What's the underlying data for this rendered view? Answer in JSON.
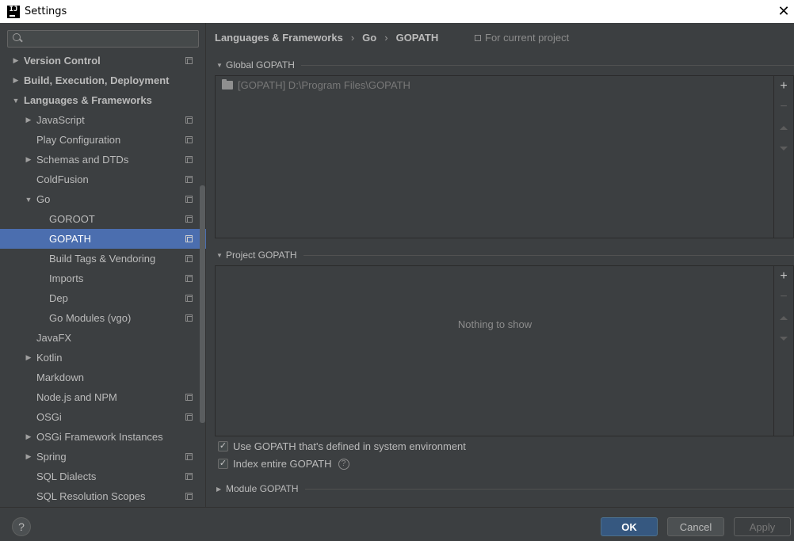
{
  "window": {
    "title": "Settings",
    "close": "✕"
  },
  "search": {
    "placeholder": ""
  },
  "tree": {
    "items": [
      {
        "label": "Version Control",
        "arrow": "▶",
        "level": 0,
        "bold": true,
        "copy": true
      },
      {
        "label": "Build, Execution, Deployment",
        "arrow": "▶",
        "level": 0,
        "bold": true,
        "copy": false
      },
      {
        "label": "Languages & Frameworks",
        "arrow": "▼",
        "level": 0,
        "bold": true,
        "copy": false
      },
      {
        "label": "JavaScript",
        "arrow": "▶",
        "level": 1,
        "copy": true
      },
      {
        "label": "Play Configuration",
        "arrow": "",
        "level": 1,
        "copy": true
      },
      {
        "label": "Schemas and DTDs",
        "arrow": "▶",
        "level": 1,
        "copy": true
      },
      {
        "label": "ColdFusion",
        "arrow": "",
        "level": 1,
        "copy": true
      },
      {
        "label": "Go",
        "arrow": "▼",
        "level": 1,
        "copy": true
      },
      {
        "label": "GOROOT",
        "arrow": "",
        "level": 2,
        "copy": true
      },
      {
        "label": "GOPATH",
        "arrow": "",
        "level": 2,
        "copy": true,
        "selected": true
      },
      {
        "label": "Build Tags & Vendoring",
        "arrow": "",
        "level": 2,
        "copy": true
      },
      {
        "label": "Imports",
        "arrow": "",
        "level": 2,
        "copy": true
      },
      {
        "label": "Dep",
        "arrow": "",
        "level": 2,
        "copy": true
      },
      {
        "label": "Go Modules (vgo)",
        "arrow": "",
        "level": 2,
        "copy": true
      },
      {
        "label": "JavaFX",
        "arrow": "",
        "level": 1,
        "copy": false
      },
      {
        "label": "Kotlin",
        "arrow": "▶",
        "level": 1,
        "copy": false
      },
      {
        "label": "Markdown",
        "arrow": "",
        "level": 1,
        "copy": false
      },
      {
        "label": "Node.js and NPM",
        "arrow": "",
        "level": 1,
        "copy": true
      },
      {
        "label": "OSGi",
        "arrow": "",
        "level": 1,
        "copy": true
      },
      {
        "label": "OSGi Framework Instances",
        "arrow": "▶",
        "level": 1,
        "copy": false
      },
      {
        "label": "Spring",
        "arrow": "▶",
        "level": 1,
        "copy": true
      },
      {
        "label": "SQL Dialects",
        "arrow": "",
        "level": 1,
        "copy": true
      },
      {
        "label": "SQL Resolution Scopes",
        "arrow": "",
        "level": 1,
        "copy": true
      }
    ]
  },
  "breadcrumb": {
    "part1": "Languages & Frameworks",
    "part2": "Go",
    "part3": "GOPATH",
    "sep": "›"
  },
  "scope": {
    "label": "For current project"
  },
  "global_gopath": {
    "header": "Global GOPATH",
    "entries": [
      {
        "text": "[GOPATH] D:\\Program Files\\GOPATH"
      }
    ]
  },
  "project_gopath": {
    "header": "Project GOPATH",
    "empty_text": "Nothing to show"
  },
  "toolbar": {
    "add": "+",
    "remove": "−"
  },
  "options": {
    "use_env": {
      "label": "Use GOPATH that's defined in system environment",
      "checked": true
    },
    "index_entire": {
      "label": "Index entire GOPATH",
      "checked": true,
      "help": "?"
    }
  },
  "module_gopath": {
    "header": "Module GOPATH"
  },
  "footer": {
    "help": "?",
    "ok": "OK",
    "cancel": "Cancel",
    "apply": "Apply"
  },
  "colors": {
    "selection": "#4b6eaf",
    "ok_button": "#365880",
    "background": "#3c3f41"
  }
}
